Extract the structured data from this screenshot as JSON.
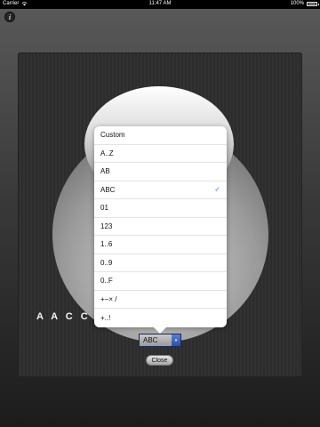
{
  "status_bar": {
    "carrier": "Carrier",
    "time": "11:47 AM",
    "battery": "100%"
  },
  "info_button": {
    "label": "i"
  },
  "panel": {
    "sequence_text": "A A C C B B"
  },
  "picker": {
    "selected_value": "ABC",
    "arrow": "▾"
  },
  "close_button": {
    "label": "Close"
  },
  "options": [
    {
      "label": "Custom"
    },
    {
      "label": "A..Z"
    },
    {
      "label": "AB"
    },
    {
      "label": "ABC",
      "checkmark": "✓"
    },
    {
      "label": "01"
    },
    {
      "label": "123"
    },
    {
      "label": "1..6"
    },
    {
      "label": "0..9"
    },
    {
      "label": "0..F"
    },
    {
      "label": "+−× /"
    },
    {
      "label": "+..!"
    }
  ],
  "colors": {
    "checkmark": "#2d7ff9",
    "select_arrow": "#3a62c2"
  }
}
